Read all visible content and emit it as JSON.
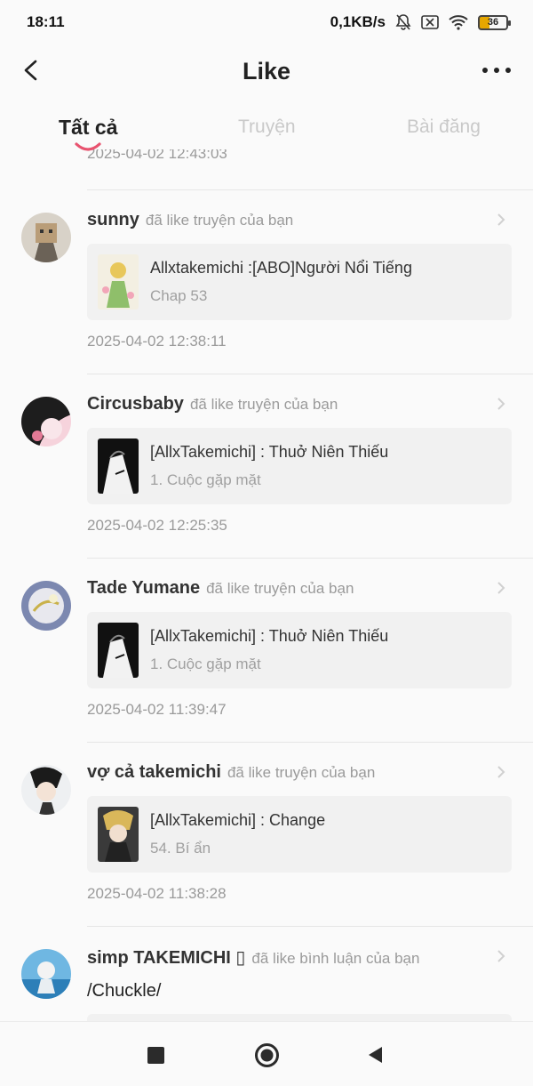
{
  "status_bar": {
    "time": "18:11",
    "speed": "0,1KB/s",
    "battery": "36"
  },
  "header": {
    "title": "Like"
  },
  "tabs": [
    {
      "label": "Tất cả",
      "active": true
    },
    {
      "label": "Truyện",
      "active": false
    },
    {
      "label": "Bài đăng",
      "active": false
    }
  ],
  "feed": {
    "top_partial_time": "2025-04-02 12:43:03",
    "items": [
      {
        "username": "sunny",
        "action": "đã like truyện của bạn",
        "card_title": "Allxtakemichi :[ABO]Người Nổi Tiếng",
        "card_subtitle": "Chap 53",
        "time": "2025-04-02 12:38:11"
      },
      {
        "username": "Circusbaby",
        "action": "đã like truyện của bạn",
        "card_title": "[AllxTakemichi] : Thuở Niên Thiếu",
        "card_subtitle": "1. Cuộc gặp mặt",
        "time": "2025-04-02 12:25:35"
      },
      {
        "username": "Tade Yumane",
        "action": "đã like truyện của bạn",
        "card_title": "[AllxTakemichi] : Thuở Niên Thiếu",
        "card_subtitle": "1. Cuộc gặp mặt",
        "time": "2025-04-02 11:39:47"
      },
      {
        "username": "vợ cả takemichi",
        "action": "đã like truyện của bạn",
        "card_title": "[AllxTakemichi] : Change",
        "card_subtitle": "54. Bí ẩn",
        "time": "2025-04-02 11:38:28"
      },
      {
        "username": "simp TAKEMICHI ▯",
        "action": "đã like bình luận của bạn",
        "comment": "/Chuckle/"
      }
    ]
  },
  "colors": {
    "accent": "#e8536f",
    "background": "#fafafa",
    "card": "#f1f1f1",
    "muted_text": "#9a9a9a"
  },
  "icons": {
    "back": "back-chevron-icon",
    "more": "more-dots-icon",
    "chevron": "chevron-right-icon",
    "nav_recents": "square-icon",
    "nav_home": "circle-icon",
    "nav_back": "triangle-back-icon"
  }
}
